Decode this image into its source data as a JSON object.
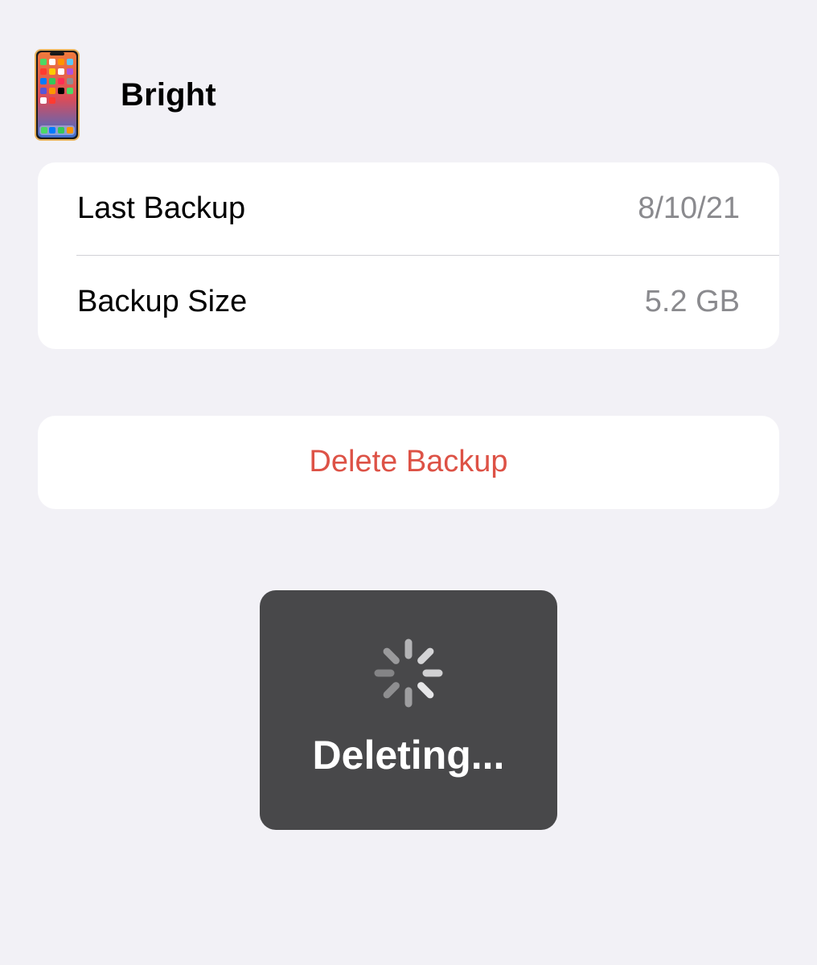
{
  "device": {
    "name": "Bright",
    "icon": "iphone-icon"
  },
  "backup_info": {
    "last_backup_label": "Last Backup",
    "last_backup_value": "8/10/21",
    "size_label": "Backup Size",
    "size_value": "5.2 GB"
  },
  "actions": {
    "delete_label": "Delete Backup"
  },
  "hud": {
    "status_text": "Deleting...",
    "icon": "activity-spinner-icon"
  },
  "colors": {
    "background": "#f2f1f6",
    "destructive": "#dd5246",
    "secondary_text": "#8a8a8e",
    "hud_background": "#48484a"
  }
}
